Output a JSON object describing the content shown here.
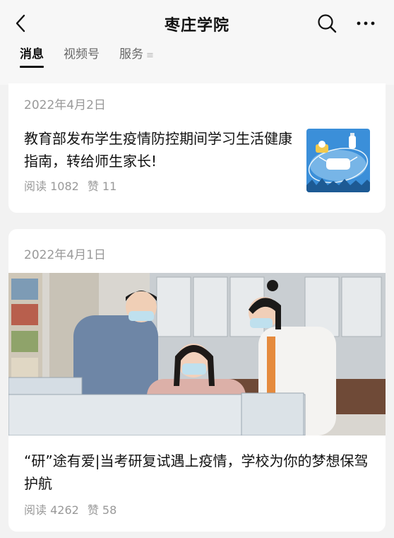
{
  "header": {
    "title": "枣庄学院",
    "back_icon": "chevron-left-icon",
    "search_icon": "search-icon",
    "more_icon": "more-horizontal-icon"
  },
  "tabs": [
    {
      "label": "消息",
      "active": true
    },
    {
      "label": "视频号",
      "active": false
    },
    {
      "label": "服务",
      "active": false,
      "menu_glyph": "≡"
    }
  ],
  "articles": [
    {
      "date": "2022年4月2日",
      "title": "教育部发布学生疫情防控期间学习生活健康指南，转给师生家长!",
      "reads": "阅读 1082",
      "likes": "赞 11",
      "thumbnail": "health-guide-illustration"
    },
    {
      "date": "2022年4月1日",
      "title": "“研”途有爱|当考研复试遇上疫情，学校为你的梦想保驾护航",
      "reads": "阅读 4262",
      "likes": "赞 58",
      "image": "office-photo-three-people-at-computer"
    }
  ],
  "colors": {
    "accent": "#111111",
    "muted": "#999999",
    "thumb_bg": "#3b8fd9"
  }
}
